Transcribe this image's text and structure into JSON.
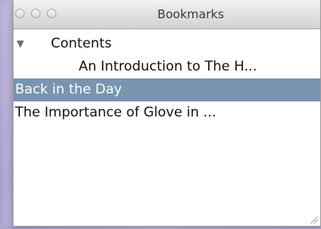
{
  "window": {
    "title": "Bookmarks"
  },
  "bookmarks": [
    {
      "label": "Contents",
      "expanded": true,
      "disclosure": "▼"
    },
    {
      "label": "An Introduction to The H...",
      "indent": 1
    },
    {
      "label": "Back in the Day",
      "selected": true
    },
    {
      "label": "The Importance of Glove in ..."
    }
  ],
  "colors": {
    "selection": "#7894b0",
    "background": "#ffffff",
    "desktop": "#b7aed6"
  },
  "icons": {
    "close": "close-icon",
    "minimize": "minimize-icon",
    "zoom": "zoom-icon",
    "disclosure": "disclosure-triangle-icon",
    "resize": "resize-grip-icon"
  }
}
